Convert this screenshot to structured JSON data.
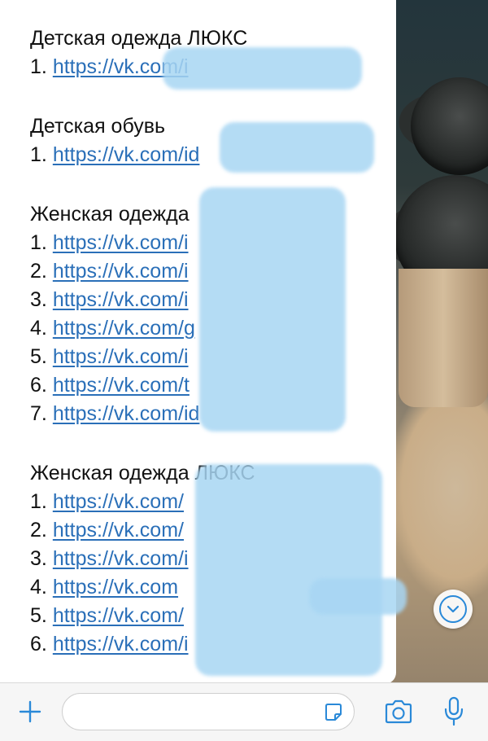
{
  "colors": {
    "link": "#2a6fb8",
    "accent": "#2a89d8",
    "redaction": "#a8d6f3",
    "bubble": "#ffffff"
  },
  "message": {
    "sections": [
      {
        "title": "Детская одежда ЛЮКС",
        "items": [
          {
            "num": "1.",
            "link": "https://vk.com/i"
          }
        ]
      },
      {
        "title": "Детская обувь",
        "items": [
          {
            "num": "1.",
            "link": "https://vk.com/id"
          }
        ]
      },
      {
        "title": "Женская одежда",
        "items": [
          {
            "num": "1.",
            "link": "https://vk.com/i"
          },
          {
            "num": "2.",
            "link": "https://vk.com/i"
          },
          {
            "num": "3.",
            "link": "https://vk.com/i"
          },
          {
            "num": "4.",
            "link": "https://vk.com/g"
          },
          {
            "num": "5.",
            "link": "https://vk.com/i"
          },
          {
            "num": "6.",
            "link": "https://vk.com/t"
          },
          {
            "num": "7.",
            "link": "https://vk.com/id"
          }
        ]
      },
      {
        "title": "Женская одежда ЛЮКС",
        "items": [
          {
            "num": "1.",
            "link": "https://vk.com/"
          },
          {
            "num": "2.",
            "link": "https://vk.com/"
          },
          {
            "num": "3.",
            "link": "https://vk.com/i"
          },
          {
            "num": "4.",
            "link": "https://vk.com"
          },
          {
            "num": "5.",
            "link": "https://vk.com/"
          },
          {
            "num": "6.",
            "link": "https://vk.com/i"
          }
        ]
      }
    ]
  },
  "icons": {
    "scroll_down": "chevron-down-icon",
    "attach": "plus-icon",
    "sticker": "sticker-icon",
    "camera": "camera-icon",
    "mic": "microphone-icon"
  },
  "composer": {
    "value": "",
    "placeholder": ""
  }
}
